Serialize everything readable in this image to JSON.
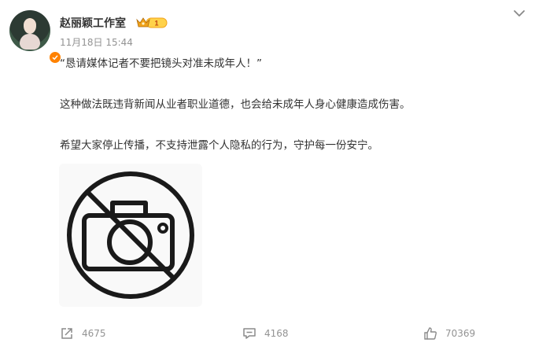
{
  "author": {
    "name": "赵丽颖工作室",
    "vip_level": "1",
    "timestamp": "11月18日 15:44"
  },
  "post": {
    "line1": "“恳请媒体记者不要把镜头对准未成年人！”",
    "line2": "这种做法既违背新闻从业者职业道德，也会给未成年人身心健康造成伤害。",
    "line3": "希望大家停止传播，不支持泄露个人隐私的行为，守护每一份安宁。",
    "image_icon": "no-camera-icon"
  },
  "actions": {
    "share_count": "4675",
    "comment_count": "4168",
    "like_count": "70369"
  },
  "colors": {
    "accent": "#ff8200",
    "muted_text": "#939393",
    "text": "#333333",
    "image_bg": "#f9f9f9"
  }
}
